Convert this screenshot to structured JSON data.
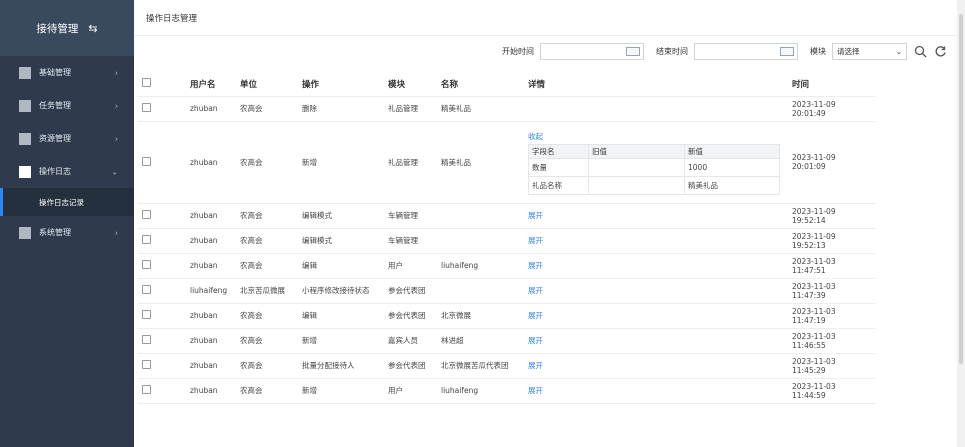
{
  "sidebar": {
    "brand": "接待管理",
    "items": [
      {
        "label": "基础管理"
      },
      {
        "label": "任务管理"
      },
      {
        "label": "资源管理"
      },
      {
        "label": "操作日志"
      },
      {
        "label": "系统管理"
      }
    ],
    "sub_label": "操作日志记录"
  },
  "header": {
    "title": "操作日志管理"
  },
  "filters": {
    "start_label": "开始时间",
    "end_label": "结束时间",
    "module_label": "模块",
    "module_value": "请选择"
  },
  "table": {
    "headers": [
      "用户名",
      "单位",
      "操作",
      "模块",
      "名称",
      "详情",
      "时间"
    ],
    "rows": [
      {
        "user": "zhuban",
        "unit": "农高会",
        "op": "删除",
        "module": "礼品管理",
        "name": "精美礼品",
        "detail": "",
        "time": "2023-11-09 20:01:49"
      },
      {
        "user": "zhuban",
        "unit": "农高会",
        "op": "新增",
        "module": "礼品管理",
        "name": "精美礼品",
        "detail": "收起",
        "time": "2023-11-09 20:01:09"
      },
      {
        "user": "zhuban",
        "unit": "农高会",
        "op": "编辑模式",
        "module": "车辆管理",
        "name": "",
        "detail": "展开",
        "time": "2023-11-09 19:52:14"
      },
      {
        "user": "zhuban",
        "unit": "农高会",
        "op": "编辑模式",
        "module": "车辆管理",
        "name": "",
        "detail": "展开",
        "time": "2023-11-09 19:52:13"
      },
      {
        "user": "zhuban",
        "unit": "农高会",
        "op": "编辑",
        "module": "用户",
        "name": "liuhaifeng",
        "detail": "展开",
        "time": "2023-11-03 11:47:51"
      },
      {
        "user": "liuhaifeng",
        "unit": "北京苦瓜微展",
        "op": "小程序修改接待状态",
        "module": "参会代表团",
        "name": "",
        "detail": "展开",
        "time": "2023-11-03 11:47:39"
      },
      {
        "user": "zhuban",
        "unit": "农高会",
        "op": "编辑",
        "module": "参会代表团",
        "name": "北京微展",
        "detail": "展开",
        "time": "2023-11-03 11:47:19"
      },
      {
        "user": "zhuban",
        "unit": "农高会",
        "op": "新增",
        "module": "嘉宾人员",
        "name": "林进超",
        "detail": "展开",
        "time": "2023-11-03 11:46:55"
      },
      {
        "user": "zhuban",
        "unit": "农高会",
        "op": "批量分配接待人",
        "module": "参会代表团",
        "name": "北京微展苦瓜代表团",
        "detail": "展开",
        "time": "2023-11-03 11:45:29"
      },
      {
        "user": "zhuban",
        "unit": "农高会",
        "op": "新增",
        "module": "用户",
        "name": "liuhaifeng",
        "detail": "展开",
        "time": "2023-11-03 11:44:59"
      }
    ],
    "detail_table": {
      "headers": [
        "字段名",
        "旧值",
        "新值"
      ],
      "rows": [
        {
          "field": "数量",
          "old": "",
          "new": "1000"
        },
        {
          "field": "礼品名称",
          "old": "",
          "new": "精美礼品"
        }
      ]
    }
  },
  "icons": {
    "switch": "swap-icon",
    "search": "search-icon",
    "refresh": "refresh-icon",
    "calendar": "calendar-icon"
  },
  "colors": {
    "sidebar": "#2f3b4c",
    "brand_bg": "#3a4a5e",
    "accent": "#2f86f6"
  }
}
